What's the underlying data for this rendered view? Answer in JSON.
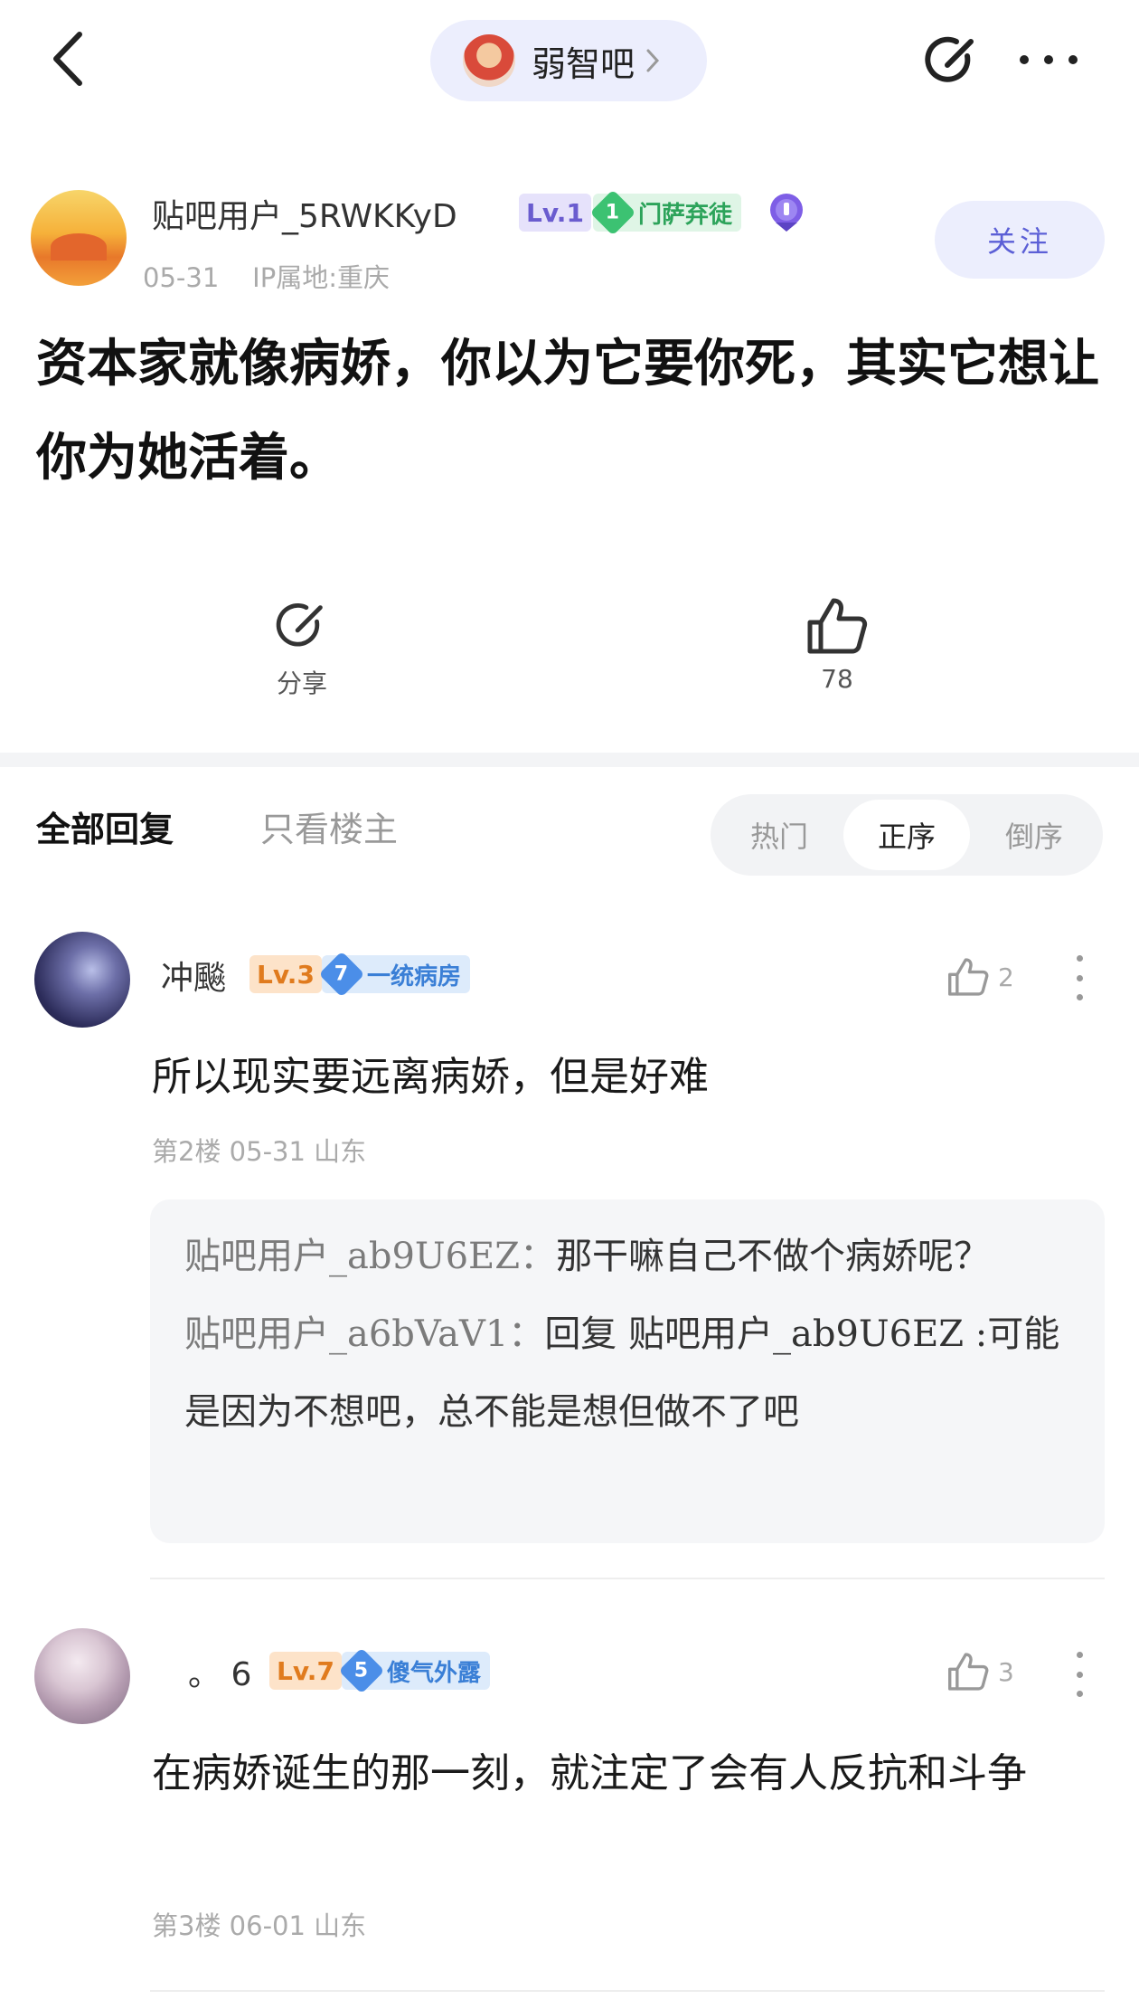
{
  "header": {
    "forum_name": "弱智吧",
    "icons": {
      "back": "back-chevron-icon",
      "edit": "edit-share-icon",
      "more": "more-dots-icon"
    }
  },
  "post": {
    "author": "贴吧用户_5RWKKyD",
    "level": "Lv.1",
    "member_level": "1",
    "member_title": "门萨弃徒",
    "date": "05-31",
    "ip": "IP属地:重庆",
    "follow_label": "关注",
    "text": "资本家就像病娇，你以为它要你死，其实它想让你为她活着。",
    "share_label": "分享",
    "likes": "78"
  },
  "tabs": {
    "all_replies": "全部回复",
    "op_only": "只看楼主",
    "sort": [
      "热门",
      "正序",
      "倒序"
    ],
    "active_sort": "正序"
  },
  "comments": [
    {
      "name": "冲飈",
      "level": "Lv.3",
      "member_level": "7",
      "member_title": "一统病房",
      "likes": "2",
      "text": "所以现实要远离病娇，但是好难",
      "meta": "第2楼  05-31  山东",
      "replies": [
        {
          "user": "贴吧用户_ab9U6EZ：",
          "text": "那干嘛自己不做个病娇呢？"
        },
        {
          "user": "贴吧用户_a6bVaV1：",
          "text": "回复 贴吧用户_ab9U6EZ :可能是因为不想吧，总不能是想但做不了吧"
        }
      ]
    },
    {
      "name": "。 6",
      "level": "Lv.7",
      "member_level": "5",
      "member_title": "傻气外露",
      "likes": "3",
      "text": "在病娇诞生的那一刻，就注定了会有人反抗和斗争",
      "meta": "第3楼  06-01  山东"
    }
  ],
  "colors": {
    "accent": "#5b5fd6",
    "pill_bg": "#eceefd",
    "level_purple": "#6a5ccf",
    "level_orange": "#e07b1e",
    "member_green": "#2ca35a",
    "member_blue": "#3a7fd6"
  }
}
